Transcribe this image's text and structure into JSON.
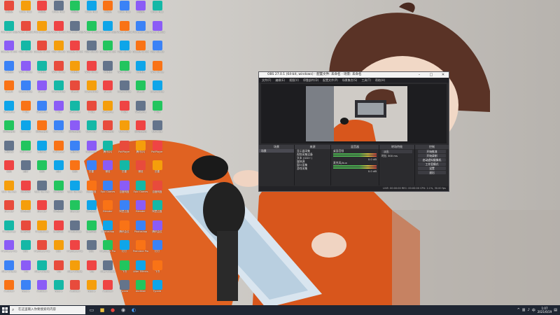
{
  "obs": {
    "title": "OBS 27.0.1 (64-bit, windows) - 配置文件: 未命名 - 场景: 未命名",
    "menu": [
      "文件(F)",
      "编辑(E)",
      "视图(V)",
      "停靠部件(D)",
      "配置文件(P)",
      "场景集合(S)",
      "工具(T)",
      "帮助(H)"
    ],
    "preview_toggle": "已暂停",
    "panel_headers": {
      "scenes": "场景",
      "sources": "来源",
      "mixer": "混音器",
      "transitions": "转场特效",
      "controls": "控制"
    },
    "scenes": [
      "场景"
    ],
    "sources": [
      "显示器采集",
      "视频采集设备",
      "文本 (GDI+)",
      "媒体源",
      "窗口采集",
      "游戏采集"
    ],
    "mixer_channels": [
      "桌面音频",
      "麦克风/Aux"
    ],
    "mixer_levels": [
      "0.0 dB",
      "0.0 dB"
    ],
    "transitions": {
      "type": "淡出",
      "duration_label": "时长",
      "duration_value": "300 ms"
    },
    "controls": [
      "开始推流",
      "开始录制",
      "启动虚拟摄像机",
      "工作室模式",
      "设置",
      "退出"
    ],
    "status": "LIVE: 00:00:00   REC: 00:00:00   CPU: 2.1%, 30.00 fps"
  },
  "taskbar": {
    "search_placeholder": "在这里输入你要搜索的内容",
    "time": "1:07",
    "date": "2021/6/19",
    "lang": "中"
  },
  "desktop_icons": [
    "回收站",
    "Microsoft Edge",
    "Google Chrome",
    "QQ音乐",
    "Steam",
    "WeGame",
    "网易云音乐",
    "腾讯QQ",
    "微信",
    "Epic Games",
    "Blender",
    "Photoshop",
    "Premiere Pro",
    "After Effects",
    "Audition",
    "Unity Hub",
    "Visual Studio",
    "OBS Studio",
    "WPS Office",
    "Everything",
    "7-Zip",
    "Bandizip",
    "PotPlayer",
    "迅雷",
    "百度网盘",
    "阿里云盘",
    "腾讯会议",
    "钉钉",
    "飞书",
    "Typora"
  ]
}
